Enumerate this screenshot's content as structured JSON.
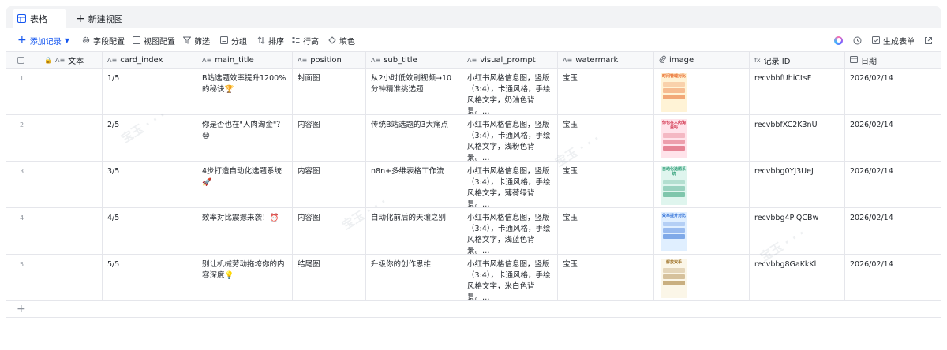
{
  "tabs": {
    "active_label": "表格",
    "new_label": "新建视图"
  },
  "toolbar": {
    "add_record": "添加记录",
    "field_config": "字段配置",
    "view_config": "视图配置",
    "filter": "筛选",
    "group": "分组",
    "sort": "排序",
    "row_height": "行高",
    "fill_color": "填色",
    "generate_form": "生成表单"
  },
  "columns": [
    "文本",
    "card_index",
    "main_title",
    "position",
    "sub_title",
    "visual_prompt",
    "watermark",
    "image",
    "记录 ID",
    "日期"
  ],
  "rows": [
    {
      "num": "1",
      "card_index": "1/5",
      "main_title": "B站选题效率提升1200%的秘诀🏆",
      "position": "封面图",
      "sub_title": "从2小时低效刷视频→10分钟精准挑选题",
      "visual_prompt": "小红书风格信息图，竖版（3:4），卡通风格，手绘风格文字，奶油色背景。…",
      "watermark": "宝玉",
      "image_title": "时间管理对比",
      "record_id": "recvbbfUhiCtsF",
      "date": "2026/02/14"
    },
    {
      "num": "2",
      "card_index": "2/5",
      "main_title": "你是否也在\"人肉淘金\"？😫",
      "position": "内容图",
      "sub_title": "传统B站选题的3大痛点",
      "visual_prompt": "小红书风格信息图，竖版（3:4），卡通风格，手绘风格文字，浅粉色背景。…",
      "watermark": "宝玉",
      "image_title": "你也在人肉淘金吗",
      "record_id": "recvbbfXC2K3nU",
      "date": "2026/02/14"
    },
    {
      "num": "3",
      "card_index": "3/5",
      "main_title": "4步打造自动化选题系统🚀",
      "position": "内容图",
      "sub_title": "n8n+多维表格工作流",
      "visual_prompt": "小红书风格信息图，竖版（3:4），卡通风格，手绘风格文字，薄荷绿背景。…",
      "watermark": "宝玉",
      "image_title": "自动化选题系统",
      "record_id": "recvbbg0YJ3UeJ",
      "date": "2026/02/14"
    },
    {
      "num": "4",
      "card_index": "4/5",
      "main_title": "效率对比震撼来袭！⏰",
      "position": "内容图",
      "sub_title": "自动化前后的天壤之别",
      "visual_prompt": "小红书风格信息图，竖版（3:4），卡通风格，手绘风格文字，浅蓝色背景。…",
      "watermark": "宝玉",
      "image_title": "效率提升对比",
      "record_id": "recvbbg4PlQCBw",
      "date": "2026/02/14"
    },
    {
      "num": "5",
      "card_index": "5/5",
      "main_title": "别让机械劳动拖垮你的内容深度💡",
      "position": "结尾图",
      "sub_title": "升级你的创作思维",
      "visual_prompt": "小红书风格信息图，竖版（3:4），卡通风格，手绘风格文字，米白色背景。…",
      "watermark": "宝玉",
      "image_title": "解放双手",
      "record_id": "recvbbg8GaKkKl",
      "date": "2026/02/14"
    }
  ],
  "colors": {
    "accent": "#1456f0",
    "border": "#e5e6eb",
    "header_bg": "#f7f8fa",
    "muted": "#8f959e"
  }
}
